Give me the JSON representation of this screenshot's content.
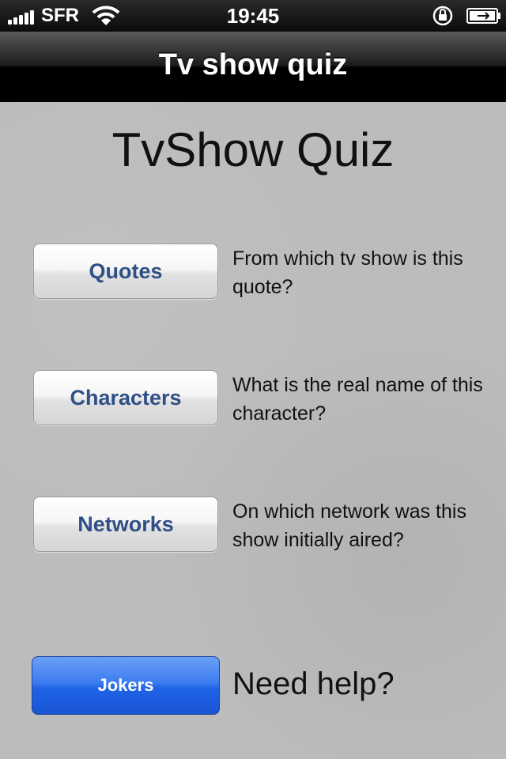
{
  "status_bar": {
    "carrier": "SFR",
    "time": "19:45",
    "icons": [
      "signal-icon",
      "wifi-icon",
      "rotation-lock-icon",
      "battery-icon"
    ]
  },
  "nav": {
    "title": "Tv show quiz"
  },
  "main": {
    "title": "TvShow Quiz",
    "modes": [
      {
        "label": "Quotes",
        "description": "From which tv show is this quote?"
      },
      {
        "label": "Characters",
        "description": "What is the real name of this character?"
      },
      {
        "label": "Networks",
        "description": "On which network was this show initially aired?"
      }
    ],
    "jokers": {
      "label": "Jokers",
      "description": "Need help?"
    }
  },
  "colors": {
    "button_text": "#2f4f86",
    "jokers_blue": "#2a6cea",
    "background": "#bcbcbc"
  }
}
